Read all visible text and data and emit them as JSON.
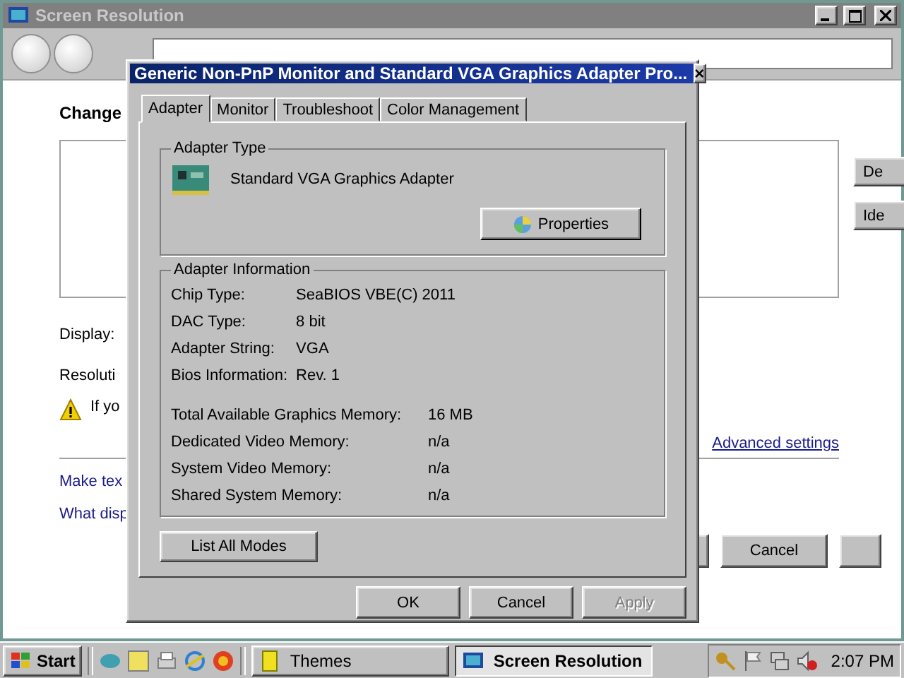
{
  "background_window": {
    "title": "Screen Resolution",
    "heading": "Change",
    "labels": [
      "Display:",
      "Resoluti"
    ],
    "warning": "If yo",
    "links": [
      "Make tex",
      "What disp"
    ],
    "advanced_link": "Advanced settings",
    "side_buttons": [
      "De",
      "Ide"
    ],
    "footer_buttons": [
      "Cancel"
    ]
  },
  "dialog": {
    "title": "Generic Non-PnP Monitor and Standard VGA Graphics Adapter Pro...",
    "close": "×",
    "tabs": [
      {
        "label": "Adapter",
        "selected": true
      },
      {
        "label": "Monitor",
        "selected": false
      },
      {
        "label": "Troubleshoot",
        "selected": false
      },
      {
        "label": "Color Management",
        "selected": false
      }
    ],
    "adapter_type": {
      "legend": "Adapter Type",
      "name": "Standard VGA Graphics Adapter",
      "button": "Properties"
    },
    "adapter_info": {
      "legend": "Adapter Information",
      "rows": [
        {
          "label": "Chip Type:",
          "value": "SeaBIOS VBE(C) 2011"
        },
        {
          "label": "DAC Type:",
          "value": "8 bit"
        },
        {
          "label": "Adapter String:",
          "value": "VGA"
        },
        {
          "label": "Bios Information:",
          "value": "Rev. 1"
        }
      ],
      "memory_rows": [
        {
          "label": "Total Available Graphics Memory:",
          "value": "16 MB"
        },
        {
          "label": "Dedicated Video Memory:",
          "value": "n/a"
        },
        {
          "label": "System Video Memory:",
          "value": "n/a"
        },
        {
          "label": "Shared System Memory:",
          "value": "n/a"
        }
      ]
    },
    "list_modes_button": "List All Modes",
    "buttons": [
      {
        "label": "OK",
        "disabled": false
      },
      {
        "label": "Cancel",
        "disabled": false
      },
      {
        "label": "Apply",
        "disabled": true
      }
    ]
  },
  "taskbar": {
    "start": "Start",
    "tasks": [
      {
        "label": "Themes",
        "selected": false
      },
      {
        "label": "Screen Resolution",
        "selected": true
      }
    ],
    "clock": "2:07 PM"
  }
}
